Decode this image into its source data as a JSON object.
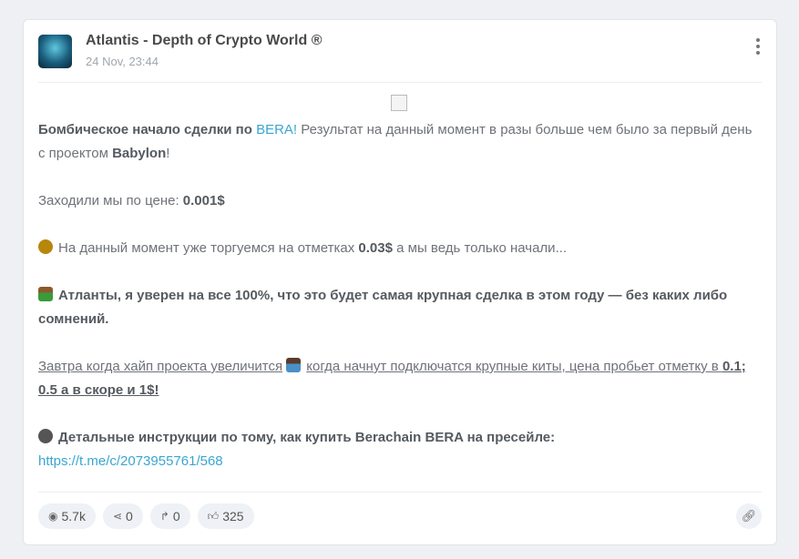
{
  "post": {
    "channel": "Atlantis - Depth of Crypto World ®",
    "date": "24 Nov, 23:44",
    "p1": {
      "a": "Бомбическое начало сделки по ",
      "b": "BERA!",
      "c": " Результат на данный момент в разы больше чем было за первый день с проектом ",
      "d": "Babylon",
      "e": "!"
    },
    "p2": {
      "a": "Заходили мы по цене: ",
      "b": "0.001$"
    },
    "p3": {
      "a": "На данный момент уже торгуемся на отметках ",
      "b": "0.03$",
      "c": " а мы ведь только начали..."
    },
    "p4": "Атланты, я уверен на все 100%, что это будет самая крупная сделка в этом году — без каких либо сомнений.",
    "p5": {
      "a": "Завтра когда хайп проекта увеличится",
      "b": "когда начнут подключатся крупные киты, цена пробьет отметку в ",
      "c": "0.1; 0.5 а в скоре и 1$!"
    },
    "p6": {
      "a": "Детальные инструкции по тому, как купить Berachain BERA на пресейле:",
      "link": "https://t.me/c/2073955761/568"
    }
  },
  "footer": {
    "views": "5.7k",
    "shares": "0",
    "forwards": "0",
    "likes": "325"
  },
  "icons": {
    "views": "eye-icon",
    "shares": "share-icon",
    "forwards": "forward-icon",
    "likes": "thumbs-up-icon",
    "link": "link-icon"
  }
}
